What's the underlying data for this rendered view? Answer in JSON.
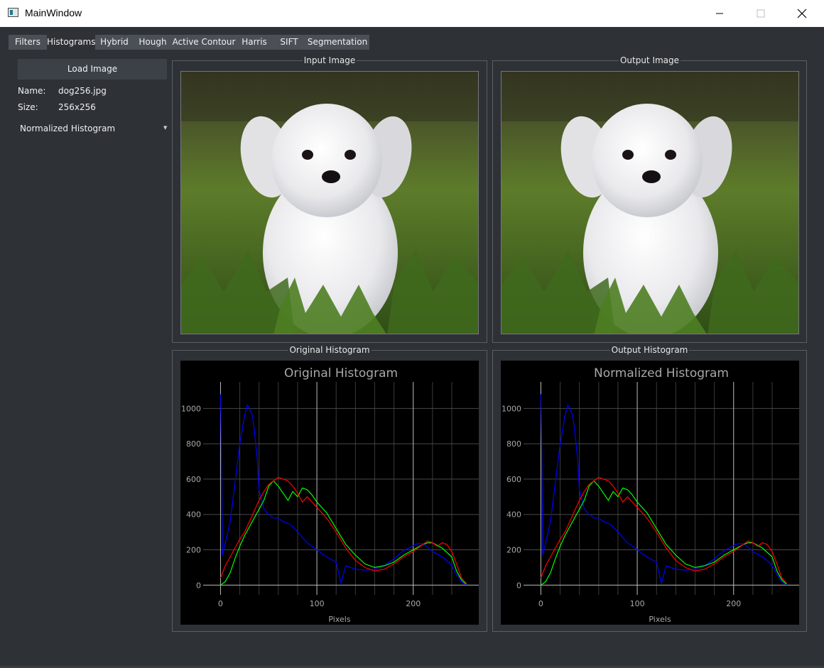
{
  "window": {
    "title": "MainWindow"
  },
  "tabs": [
    "Filters",
    "Histograms",
    "Hybrid",
    "Hough",
    "Active Contour",
    "Harris",
    "SIFT",
    "Segmentation"
  ],
  "sidebar": {
    "load_button": "Load Image",
    "name_label": "Name:",
    "name_value": "dog256.jpg",
    "size_label": "Size:",
    "size_value": "256x256",
    "histogram_type": "Normalized Histogram"
  },
  "groups": {
    "input_image": "Input Image",
    "output_image": "Output Image",
    "original_histogram": "Original Histogram",
    "output_histogram": "Output Histogram"
  },
  "colors": {
    "background": "#2e3237",
    "tab": "#4b5057",
    "red": "#ff0000",
    "green": "#00ff00",
    "blue": "#0000ff"
  },
  "chart_data": [
    {
      "type": "line",
      "title": "Original Histogram",
      "xlabel": "Pixels",
      "ylabel": "",
      "xlim": [
        -18,
        268
      ],
      "ylim": [
        -55,
        1150
      ],
      "xticks": [
        0,
        100,
        200
      ],
      "yticks": [
        0,
        200,
        400,
        600,
        800,
        1000
      ],
      "grid": true,
      "series": [
        {
          "color": "#0000ff",
          "x": [
            0,
            1,
            2,
            5,
            10,
            15,
            20,
            25,
            28,
            30,
            33,
            35,
            38,
            40,
            45,
            50,
            55,
            60,
            65,
            70,
            75,
            80,
            90,
            100,
            110,
            120,
            125,
            130,
            140,
            150,
            160,
            170,
            180,
            190,
            200,
            205,
            210,
            215,
            220,
            225,
            230,
            235,
            240,
            245,
            250,
            255
          ],
          "values": [
            1080,
            700,
            170,
            240,
            360,
            580,
            800,
            960,
            1020,
            1000,
            960,
            880,
            720,
            540,
            430,
            400,
            380,
            380,
            360,
            350,
            330,
            300,
            240,
            200,
            160,
            130,
            10,
            110,
            90,
            85,
            90,
            110,
            150,
            195,
            225,
            235,
            235,
            215,
            190,
            175,
            160,
            140,
            110,
            60,
            20,
            0
          ]
        },
        {
          "color": "#00ff00",
          "x": [
            0,
            5,
            10,
            15,
            20,
            25,
            30,
            35,
            40,
            45,
            50,
            55,
            60,
            65,
            70,
            75,
            80,
            85,
            90,
            95,
            100,
            110,
            120,
            130,
            140,
            150,
            160,
            170,
            180,
            190,
            200,
            210,
            215,
            220,
            225,
            230,
            235,
            240,
            245,
            250,
            255
          ],
          "values": [
            0,
            20,
            70,
            150,
            220,
            280,
            330,
            380,
            430,
            480,
            560,
            590,
            560,
            520,
            480,
            530,
            500,
            550,
            540,
            510,
            470,
            410,
            320,
            230,
            170,
            120,
            100,
            110,
            130,
            170,
            200,
            230,
            240,
            240,
            225,
            210,
            185,
            160,
            80,
            30,
            5
          ]
        },
        {
          "color": "#ff0000",
          "x": [
            0,
            5,
            10,
            15,
            20,
            25,
            30,
            35,
            40,
            45,
            50,
            55,
            60,
            65,
            70,
            75,
            80,
            85,
            90,
            100,
            110,
            120,
            130,
            140,
            150,
            160,
            170,
            180,
            190,
            200,
            210,
            215,
            220,
            225,
            230,
            235,
            240,
            245,
            250,
            255
          ],
          "values": [
            40,
            110,
            160,
            210,
            260,
            300,
            360,
            420,
            480,
            530,
            570,
            590,
            610,
            600,
            590,
            560,
            520,
            470,
            500,
            440,
            380,
            300,
            210,
            140,
            100,
            80,
            90,
            120,
            160,
            190,
            230,
            250,
            240,
            220,
            240,
            230,
            190,
            120,
            40,
            10
          ]
        }
      ]
    },
    {
      "type": "line",
      "title": "Normalized Histogram",
      "xlabel": "Pixels",
      "ylabel": "",
      "xlim": [
        -18,
        268
      ],
      "ylim": [
        -55,
        1150
      ],
      "xticks": [
        0,
        100,
        200
      ],
      "yticks": [
        0,
        200,
        400,
        600,
        800,
        1000
      ],
      "grid": true,
      "series": [
        {
          "color": "#0000ff",
          "x": [
            0,
            1,
            2,
            5,
            10,
            15,
            20,
            25,
            28,
            30,
            33,
            35,
            38,
            40,
            45,
            50,
            55,
            60,
            65,
            70,
            75,
            80,
            90,
            100,
            110,
            120,
            125,
            130,
            140,
            150,
            160,
            170,
            180,
            190,
            200,
            205,
            210,
            215,
            220,
            225,
            230,
            235,
            240,
            245,
            250,
            255
          ],
          "values": [
            1080,
            700,
            170,
            240,
            360,
            580,
            800,
            960,
            1020,
            1000,
            960,
            880,
            720,
            540,
            430,
            400,
            380,
            380,
            360,
            350,
            330,
            300,
            240,
            200,
            160,
            130,
            10,
            110,
            90,
            85,
            90,
            110,
            150,
            195,
            225,
            235,
            235,
            215,
            190,
            175,
            160,
            140,
            110,
            60,
            20,
            0
          ]
        },
        {
          "color": "#00ff00",
          "x": [
            0,
            5,
            10,
            15,
            20,
            25,
            30,
            35,
            40,
            45,
            50,
            55,
            60,
            65,
            70,
            75,
            80,
            85,
            90,
            95,
            100,
            110,
            120,
            130,
            140,
            150,
            160,
            170,
            180,
            190,
            200,
            210,
            215,
            220,
            225,
            230,
            235,
            240,
            245,
            250,
            255
          ],
          "values": [
            0,
            20,
            70,
            150,
            220,
            280,
            330,
            380,
            430,
            480,
            560,
            590,
            560,
            520,
            480,
            530,
            500,
            550,
            540,
            510,
            470,
            410,
            320,
            230,
            170,
            120,
            100,
            110,
            130,
            170,
            200,
            230,
            240,
            240,
            225,
            210,
            185,
            160,
            80,
            30,
            5
          ]
        },
        {
          "color": "#ff0000",
          "x": [
            0,
            5,
            10,
            15,
            20,
            25,
            30,
            35,
            40,
            45,
            50,
            55,
            60,
            65,
            70,
            75,
            80,
            85,
            90,
            100,
            110,
            120,
            130,
            140,
            150,
            160,
            170,
            180,
            190,
            200,
            210,
            215,
            220,
            225,
            230,
            235,
            240,
            245,
            250,
            255
          ],
          "values": [
            40,
            110,
            160,
            210,
            260,
            300,
            360,
            420,
            480,
            530,
            570,
            590,
            610,
            600,
            590,
            560,
            520,
            470,
            500,
            440,
            380,
            300,
            210,
            140,
            100,
            80,
            90,
            120,
            160,
            190,
            230,
            250,
            240,
            220,
            240,
            230,
            190,
            120,
            40,
            10
          ]
        }
      ]
    }
  ]
}
